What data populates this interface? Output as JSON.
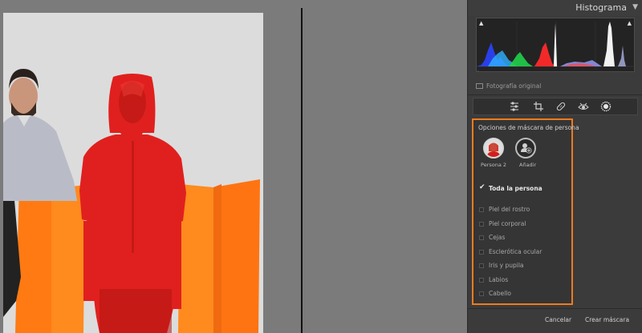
{
  "histogram": {
    "title": "Histograma",
    "collapse_glyph": "▼",
    "clip_warning_glyph": "▲",
    "original_photo_label": "Fotografía original"
  },
  "toolbar": {
    "tools": [
      "edit-sliders-icon",
      "crop-icon",
      "healing-icon",
      "red-eye-icon",
      "masking-icon"
    ]
  },
  "mask_panel": {
    "title": "Opciones de máscara de persona",
    "accent_color": "#ef7b1f",
    "person_label": "Persona 2",
    "add_label": "Añadir",
    "options": [
      {
        "label": "Toda la persona",
        "checked": true
      },
      {
        "label": "Piel del rostro",
        "checked": false
      },
      {
        "label": "Piel corporal",
        "checked": false
      },
      {
        "label": "Cejas",
        "checked": false
      },
      {
        "label": "Esclerótica ocular",
        "checked": false
      },
      {
        "label": "Iris y pupila",
        "checked": false
      },
      {
        "label": "Labios",
        "checked": false
      },
      {
        "label": "Cabello",
        "checked": false
      }
    ]
  },
  "footer": {
    "cancel_label": "Cancelar",
    "create_label": "Crear máscara"
  },
  "colors": {
    "mask_overlay": "#e0201e",
    "panel_bg": "#3b3b3b",
    "canvas_bg": "#7b7b7b"
  }
}
